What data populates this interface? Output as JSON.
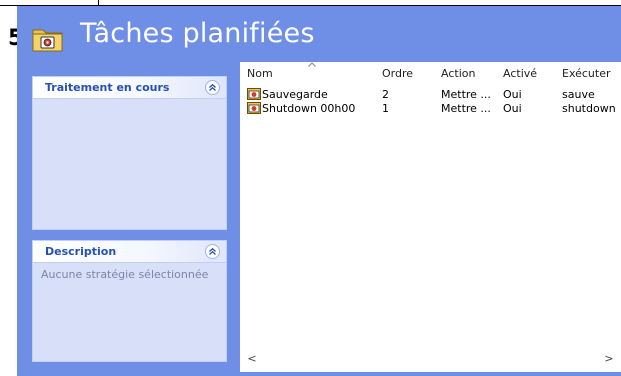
{
  "step_number": "5",
  "window": {
    "title": "Tâches planifiées"
  },
  "panels": {
    "processing": {
      "title": "Traitement en cours"
    },
    "description": {
      "title": "Description",
      "text": "Aucune stratégie sélectionnée"
    }
  },
  "list": {
    "columns": [
      "Nom",
      "Ordre",
      "Action",
      "Activé",
      "Exécuter"
    ],
    "rows": [
      {
        "name": "Sauvegarde",
        "order": "2",
        "action": "Mettre ...",
        "enabled": "Oui",
        "run": "sauve"
      },
      {
        "name": "Shutdown 00h00",
        "order": "1",
        "action": "Mettre ...",
        "enabled": "Oui",
        "run": "shutdown"
      }
    ]
  },
  "scrollbar": {
    "left_arrow": "<",
    "right_arrow": ">"
  },
  "colors": {
    "window_background": "#6f8ee6",
    "panel_background": "#d7e0f8",
    "panel_title": "#2551b4"
  },
  "icons": {
    "title": "folder-icon",
    "collapse": "chevron-double-up-icon",
    "task": "scheduled-task-icon",
    "sort": "sort-ascending-icon"
  }
}
